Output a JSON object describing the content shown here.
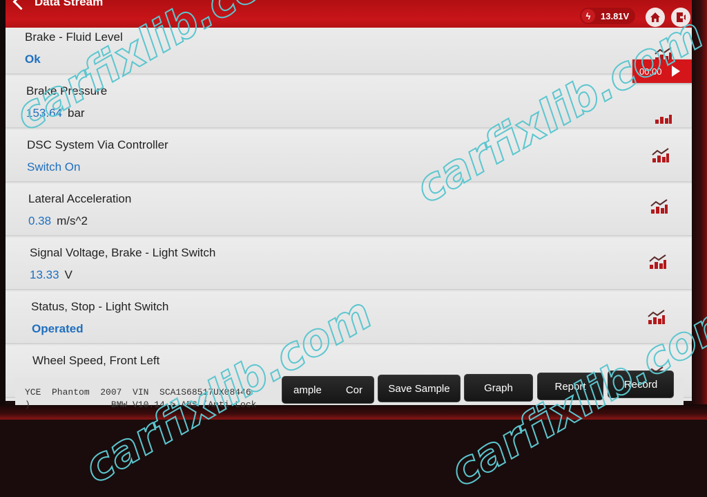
{
  "header": {
    "title": "Data Stream",
    "battery_voltage": "13.81V"
  },
  "rows": [
    {
      "name": "Brake - Fluid Level",
      "value": "Ok",
      "unit": ""
    },
    {
      "name": "Brake Pressure",
      "value": "153.64",
      "unit": "bar"
    },
    {
      "name": "DSC System Via Controller",
      "value": "Switch On",
      "unit": ""
    },
    {
      "name": "Lateral Acceleration",
      "value": "0.38",
      "unit": "m/s^2"
    },
    {
      "name": "Signal Voltage, Brake - Light Switch",
      "value": "13.33",
      "unit": "V"
    },
    {
      "name": "Status, Stop - Light Switch",
      "value": "Operated",
      "unit": ""
    },
    {
      "name": "Wheel Speed, Front Left",
      "value": "",
      "unit": ""
    }
  ],
  "timer": {
    "elapsed": "00:00"
  },
  "footer": {
    "vehicle_line1": "YCE  Phantom  2007  VIN  SCA1S68517UX08446",
    "vehicle_line2": ")               BMW V10.14 > ABS (Anti-Lock",
    "buttons": {
      "compare_left": "ample",
      "compare_right": "Cor",
      "save_sample": "Save Sample",
      "graph": "Graph",
      "report": "Report",
      "record": "Record"
    }
  },
  "watermark": {
    "text": "carfixlib.com"
  },
  "colors": {
    "header_red": "#c8151a",
    "value_blue": "#1f6fbf",
    "icon_red": "#b3191c"
  }
}
